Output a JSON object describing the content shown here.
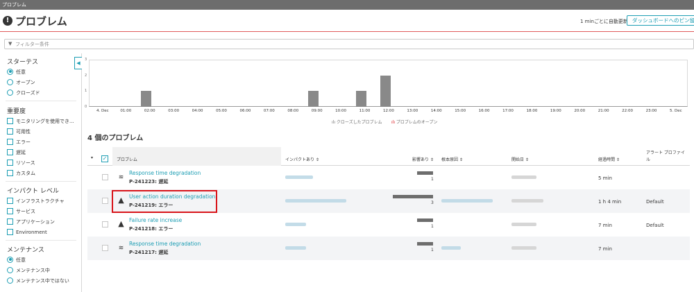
{
  "window": {
    "tab_title": "プロブレム"
  },
  "header": {
    "title": "プロブレム",
    "refresh_text": "1 minごとに自動更新",
    "pin_button": "ダッシュボードへのピン留め"
  },
  "filter": {
    "placeholder": "フィルター条件"
  },
  "sidebar": {
    "status": {
      "title": "スターテス",
      "options": [
        "任意",
        "オープン",
        "クローズド"
      ],
      "selected": "任意"
    },
    "severity": {
      "title": "重要度",
      "options": [
        "モニタリングを使用でき...",
        "可用性",
        "エラー",
        "遅延",
        "リソース",
        "カスタム"
      ]
    },
    "impact": {
      "title": "インパクト レベル",
      "options": [
        "インフラストラクチャ",
        "サービス",
        "アプリケーション",
        "Environment"
      ]
    },
    "maintenance": {
      "title": "メンテナンス",
      "options": [
        "任意",
        "メンテナンス中",
        "メンテナンス中ではない"
      ],
      "selected": "任意"
    }
  },
  "chart_data": {
    "type": "bar",
    "categories": [
      "4. Dec",
      "01:00",
      "02:00",
      "03:00",
      "04:00",
      "05:00",
      "06:00",
      "07:00",
      "08:00",
      "09:00",
      "10:00",
      "11:00",
      "12:00",
      "13:00",
      "14:00",
      "15:00",
      "16:00",
      "17:00",
      "18:00",
      "19:00",
      "20:00",
      "21:00",
      "22:00",
      "23:00",
      "5. Dec"
    ],
    "series": [
      {
        "name": "プロブレムのオープン",
        "values": [
          0,
          1,
          0,
          0,
          0,
          0,
          0,
          0,
          1,
          0,
          1,
          2,
          0,
          0,
          0,
          0,
          0,
          0,
          0,
          0,
          0,
          0,
          0,
          0,
          0
        ]
      }
    ],
    "yticks": [
      "3",
      "2",
      "1",
      "0"
    ],
    "ylim": [
      0,
      3
    ],
    "legend": [
      "クローズしたプロブレム",
      "プロブレムのオープン"
    ],
    "legend_position": "bottom-center"
  },
  "list": {
    "count_title": "4 個のプロブレム",
    "columns": [
      "プロブレム",
      "インパクトあり ⇕",
      "影響あり ⇕",
      "根本原因 ⇕",
      "開始日 ⇕",
      "経過時間 ⇕",
      "アラート プロファイル"
    ],
    "rows": [
      {
        "icon": "slowdown-icon",
        "title": "Response time degradation",
        "id": "P-241223: 遅延",
        "affected": "1",
        "affected_frac": 0.4,
        "duration": "5 min",
        "alert_profile": ""
      },
      {
        "icon": "warning-icon",
        "title": "User action duration degradation",
        "id": "P-241219: エラー",
        "affected": "3",
        "affected_frac": 1.0,
        "duration": "1 h 4 min",
        "alert_profile": "Default"
      },
      {
        "icon": "warning-icon",
        "title": "Failure rate increase",
        "id": "P-241218: エラー",
        "affected": "1",
        "affected_frac": 0.4,
        "duration": "7 min",
        "alert_profile": "Default"
      },
      {
        "icon": "slowdown-icon",
        "title": "Response time degradation",
        "id": "P-241217: 遅延",
        "affected": "1",
        "affected_frac": 0.4,
        "duration": "7 min",
        "alert_profile": ""
      }
    ]
  },
  "colors": {
    "accent": "#1c9db3",
    "highlight": "#d8141a",
    "bar": "#898989"
  }
}
